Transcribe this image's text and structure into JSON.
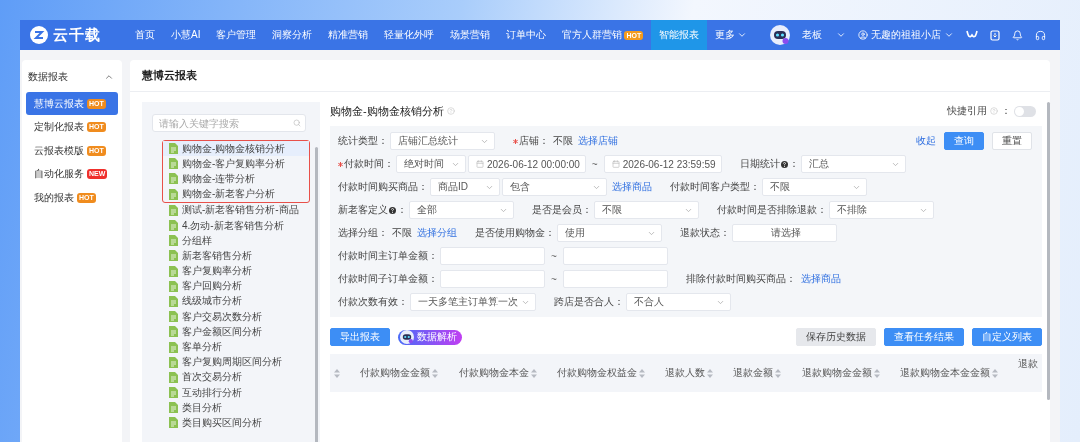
{
  "nav": {
    "brand": "云千载",
    "items": [
      {
        "label": "首页",
        "selected": false
      },
      {
        "label": "小慧AI",
        "selected": false
      },
      {
        "label": "客户管理",
        "selected": false
      },
      {
        "label": "洞察分析",
        "selected": false
      },
      {
        "label": "精准营销",
        "selected": false
      },
      {
        "label": "轻量化外呼",
        "selected": false
      },
      {
        "label": "场景营销",
        "selected": false
      },
      {
        "label": "订单中心",
        "selected": false
      },
      {
        "label": "官方人群营销",
        "selected": false,
        "badge": "HOT"
      },
      {
        "label": "智能报表",
        "selected": true
      },
      {
        "label": "更多",
        "selected": false,
        "dropdown": true
      }
    ],
    "role": "老板",
    "shop": "无趣的祖祖小店"
  },
  "sidebar": {
    "title": "数据报表",
    "expanded": true,
    "items": [
      {
        "label": "慧博云报表",
        "selected": true,
        "badge": {
          "text": "HOT",
          "color": "#f08c1e"
        }
      },
      {
        "label": "定制化报表",
        "selected": false,
        "badge": {
          "text": "HOT",
          "color": "#f08c1e"
        }
      },
      {
        "label": "云报表模版",
        "selected": false,
        "badge": {
          "text": "HOT",
          "color": "#f08c1e"
        }
      },
      {
        "label": "自动化服务",
        "selected": false,
        "badge": {
          "text": "NEW",
          "color": "#f0302c"
        }
      },
      {
        "label": "我的报表",
        "selected": false,
        "badge": {
          "text": "HOT",
          "color": "#f08c1e"
        }
      }
    ]
  },
  "page_title": "慧博云报表",
  "tree": {
    "search_placeholder": "请输入关键字搜索",
    "items": [
      {
        "label": "购物金-购物金核销分析",
        "selected": true,
        "outlined": true
      },
      {
        "label": "购物金-客户复购率分析",
        "selected": false,
        "outlined": true
      },
      {
        "label": "购物金-连带分析",
        "selected": false,
        "outlined": true
      },
      {
        "label": "购物金-新老客户分析",
        "selected": false,
        "outlined": true
      },
      {
        "label": "测试-新老客销售分析-商品",
        "selected": false,
        "outlined": false
      },
      {
        "label": "4.勿动-新老客销售分析",
        "selected": false,
        "outlined": false
      },
      {
        "label": "分组样",
        "selected": false,
        "outlined": false
      },
      {
        "label": "新老客销售分析",
        "selected": false,
        "outlined": false
      },
      {
        "label": "客户复购率分析",
        "selected": false,
        "outlined": false
      },
      {
        "label": "客户回购分析",
        "selected": false,
        "outlined": false
      },
      {
        "label": "线级城市分析",
        "selected": false,
        "outlined": false
      },
      {
        "label": "客户交易次数分析",
        "selected": false,
        "outlined": false
      },
      {
        "label": "客户金额区间分析",
        "selected": false,
        "outlined": false
      },
      {
        "label": "客单分析",
        "selected": false,
        "outlined": false
      },
      {
        "label": "客户复购周期区间分析",
        "selected": false,
        "outlined": false
      },
      {
        "label": "首次交易分析",
        "selected": false,
        "outlined": false
      },
      {
        "label": "互动排行分析",
        "selected": false,
        "outlined": false
      },
      {
        "label": "类目分析",
        "selected": false,
        "outlined": false
      },
      {
        "label": "类目购买区间分析",
        "selected": false,
        "outlined": false
      }
    ]
  },
  "report": {
    "title": "购物金-购物金核销分析",
    "quick_ref": {
      "label": "快捷引用",
      "colon": "：",
      "on": false
    },
    "actions": {
      "collapse": "收起",
      "query": "查询",
      "reset": "重置"
    },
    "filter_rows": [
      [
        {
          "kind": "label",
          "text": "统计类型："
        },
        {
          "kind": "select",
          "value": "店铺汇总统计"
        },
        {
          "kind": "label",
          "text": "店铺：",
          "required": true
        },
        {
          "kind": "text",
          "text": "不限"
        },
        {
          "kind": "link",
          "text": "选择店铺"
        }
      ],
      [
        {
          "kind": "label",
          "text": "付款时间：",
          "required": true
        },
        {
          "kind": "mini",
          "value": "绝对时间"
        },
        {
          "kind": "date",
          "value": "2026-06-12 00:00:00"
        },
        {
          "kind": "sep",
          "text": "~"
        },
        {
          "kind": "date",
          "value": "2026-06-12 23:59:59"
        },
        {
          "kind": "label",
          "text": "日期统计",
          "help": true,
          "colon": "："
        },
        {
          "kind": "select",
          "value": "汇总"
        }
      ],
      [
        {
          "kind": "label",
          "text": "付款时间购买商品："
        },
        {
          "kind": "mini",
          "value": "商品ID"
        },
        {
          "kind": "select",
          "value": "包含"
        },
        {
          "kind": "link",
          "text": "选择商品"
        },
        {
          "kind": "label",
          "text": "付款时间客户类型："
        },
        {
          "kind": "select",
          "value": "不限"
        }
      ],
      [
        {
          "kind": "label",
          "text": "新老客定义",
          "help": true,
          "colon": "："
        },
        {
          "kind": "select",
          "value": "全部"
        },
        {
          "kind": "label",
          "text": "是否是会员："
        },
        {
          "kind": "select",
          "value": "不限"
        },
        {
          "kind": "label",
          "text": "付款时间是否排除退款："
        },
        {
          "kind": "select",
          "value": "不排除"
        }
      ],
      [
        {
          "kind": "label",
          "text": "选择分组："
        },
        {
          "kind": "text",
          "text": "不限"
        },
        {
          "kind": "link",
          "text": "选择分组"
        },
        {
          "kind": "label",
          "text": "是否使用购物金："
        },
        {
          "kind": "select",
          "value": "使用"
        },
        {
          "kind": "label",
          "text": "退款状态："
        },
        {
          "kind": "picker",
          "value": "请选择"
        }
      ],
      [
        {
          "kind": "label",
          "text": "付款时间主订单金额："
        },
        {
          "kind": "input"
        },
        {
          "kind": "sep",
          "text": "~"
        },
        {
          "kind": "input"
        }
      ],
      [
        {
          "kind": "label",
          "text": "付款时间子订单金额："
        },
        {
          "kind": "input"
        },
        {
          "kind": "sep",
          "text": "~"
        },
        {
          "kind": "input"
        },
        {
          "kind": "label",
          "text": "排除付款时间购买商品："
        },
        {
          "kind": "link",
          "text": "选择商品"
        }
      ],
      [
        {
          "kind": "label",
          "text": "付款次数有效："
        },
        {
          "kind": "select",
          "value": "一天多笔主订单算一次"
        },
        {
          "kind": "label",
          "text": "跨店是否合人："
        },
        {
          "kind": "select",
          "value": "不合人"
        }
      ]
    ],
    "toolbar": {
      "export": "导出报表",
      "ai": "数据解析",
      "buttons": [
        {
          "label": "保存历史数据",
          "kind": "plain"
        },
        {
          "label": "查看任务结果",
          "kind": "primary"
        },
        {
          "label": "自定义列表",
          "kind": "primary"
        }
      ]
    },
    "columns": [
      "付款购物金金额",
      "付款购物金本金",
      "付款购物金权益金",
      "退款人数",
      "退款金额",
      "退款购物金金额",
      "退款购物金本金金额",
      "退款"
    ]
  }
}
